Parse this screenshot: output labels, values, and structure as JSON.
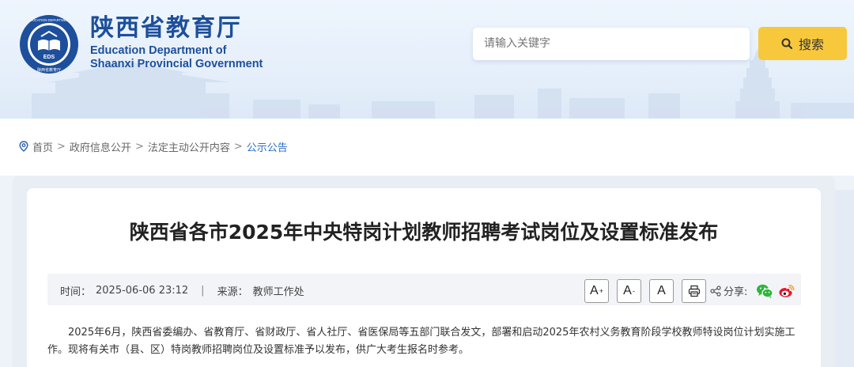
{
  "header": {
    "site_name_cn": "陕西省教育厅",
    "site_name_en_line1": "Education Department of",
    "site_name_en_line2": "Shaanxi Provincial Government",
    "emblem_text_top": "EDUCATION DEPARTMENT OF SHAANXI",
    "emblem_text_bottom": "陕西省教育厅",
    "emblem_center": "EDS",
    "search_placeholder": "请输入关键字",
    "search_button_label": "搜索",
    "colors": {
      "brand": "#1d4f9c",
      "search_button": "#f8c83c"
    }
  },
  "breadcrumb": {
    "items": [
      "首页",
      "政府信息公开",
      "法定主动公开内容",
      "公示公告"
    ],
    "separator": ">"
  },
  "article": {
    "title": "陕西省各市2025年中央特岗计划教师招聘考试岗位及设置标准发布",
    "time_label": "时间：",
    "time_value": "2025-06-06 23:12",
    "source_label": "来源：",
    "source_value": "教师工作处",
    "font_buttons": [
      "A",
      "A",
      "A"
    ],
    "font_button_marks": [
      "+",
      "-",
      ""
    ],
    "share_label": "分享:",
    "body": "2025年6月，陕西省委编办、省教育厅、省财政厅、省人社厅、省医保局等五部门联合发文，部署和启动2025年农村义务教育阶段学校教师特设岗位计划实施工作。现将有关市（县、区）特岗教师招聘岗位及设置标准予以发布，供广大考生报名时参考。"
  }
}
